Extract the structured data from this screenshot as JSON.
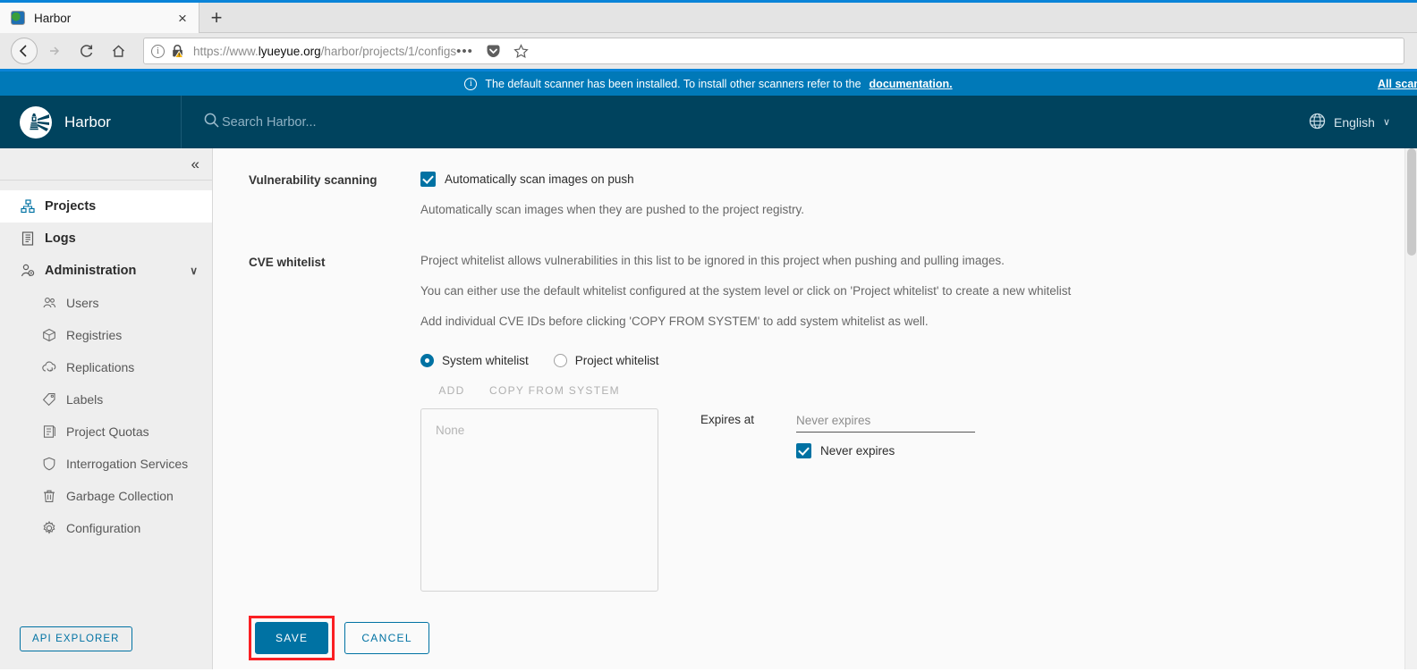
{
  "browser": {
    "tab": {
      "title": "Harbor",
      "favicon": "harbor-favicon",
      "close_label": "×"
    },
    "new_tab_label": "+",
    "nav": {
      "back": "←",
      "forward": "→",
      "reload": "↻",
      "home": "⌂"
    },
    "url": {
      "scheme": "https://www.",
      "host": "lyueyue.org",
      "path": "/harbor/projects/1/configs",
      "full": "https://www.lyueyue.org/harbor/projects/1/configs",
      "info_icon": "info-icon",
      "lock_icon": "lock-warning-icon"
    },
    "toolbar": {
      "menu_dots": "•••",
      "pocket_icon": "pocket-icon",
      "bookmark_icon": "star-icon"
    }
  },
  "banner": {
    "icon": "info-icon",
    "message": "The default scanner has been installed. To install other scanners refer to the",
    "doc_link": "documentation.",
    "right_link": "All scanners"
  },
  "header": {
    "logo": "harbor-lighthouse-logo",
    "title": "Harbor",
    "search_placeholder": "Search Harbor...",
    "search_value": "",
    "search_icon": "search-icon",
    "language": "English",
    "language_icon": "globe-icon",
    "language_caret": "∨"
  },
  "sidebar": {
    "collapse_icon": "«",
    "items": [
      {
        "label": "Projects",
        "icon": "projects-icon",
        "level": "top",
        "active": true
      },
      {
        "label": "Logs",
        "icon": "logs-icon",
        "level": "top",
        "active": false
      },
      {
        "label": "Administration",
        "icon": "administration-icon",
        "level": "top",
        "active": false,
        "caret": "∨"
      },
      {
        "label": "Users",
        "icon": "users-icon",
        "level": "sub",
        "active": false
      },
      {
        "label": "Registries",
        "icon": "registries-icon",
        "level": "sub",
        "active": false
      },
      {
        "label": "Replications",
        "icon": "replications-icon",
        "level": "sub",
        "active": false
      },
      {
        "label": "Labels",
        "icon": "labels-icon",
        "level": "sub",
        "active": false
      },
      {
        "label": "Project Quotas",
        "icon": "project-quotas-icon",
        "level": "sub",
        "active": false
      },
      {
        "label": "Interrogation Services",
        "icon": "shield-icon",
        "level": "sub",
        "active": false
      },
      {
        "label": "Garbage Collection",
        "icon": "trash-icon",
        "level": "sub",
        "active": false
      },
      {
        "label": "Configuration",
        "icon": "gear-icon",
        "level": "sub",
        "active": false
      }
    ],
    "api_explorer_label": "API EXPLORER"
  },
  "main": {
    "vulnerability": {
      "section_label": "Vulnerability scanning",
      "checkbox_label": "Automatically scan images on push",
      "checkbox_checked": true,
      "help": "Automatically scan images when they are pushed to the project registry."
    },
    "cve_whitelist": {
      "section_label": "CVE whitelist",
      "help_lines": [
        "Project whitelist allows vulnerabilities in this list to be ignored in this project when pushing and pulling images.",
        "You can either use the default whitelist configured at the system level or click on 'Project whitelist' to create a new whitelist",
        "Add individual CVE IDs before clicking 'COPY FROM SYSTEM' to add system whitelist as well."
      ],
      "radios": [
        {
          "label": "System whitelist",
          "selected": true
        },
        {
          "label": "Project whitelist",
          "selected": false
        }
      ],
      "add_label": "ADD",
      "copy_label": "COPY FROM SYSTEM",
      "add_disabled": true,
      "copy_disabled": true,
      "list_empty_text": "None",
      "expires_label": "Expires at",
      "expires_placeholder": "Never expires",
      "expires_value": "",
      "never_expires_label": "Never expires",
      "never_expires_checked": true
    },
    "actions": {
      "save_label": "SAVE",
      "cancel_label": "CANCEL",
      "save_highlight_color": "#fa1f23"
    }
  },
  "colors": {
    "banner_blue": "#0079b8",
    "header_blue": "#00435e",
    "accent": "#0072a3",
    "sidebar_bg": "#eeeeee",
    "content_bg": "#fafafa",
    "highlight_red": "#fa1f23"
  }
}
